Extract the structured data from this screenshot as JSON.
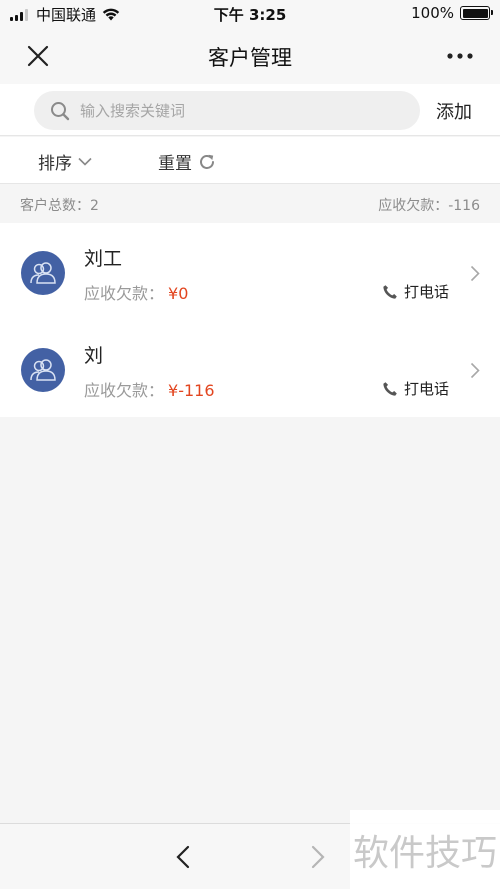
{
  "status_bar": {
    "carrier": "中国联通",
    "time": "下午 3:25",
    "battery": "100%",
    "battery_level": 1.0,
    "signal_bars": 3,
    "signal_total": 4
  },
  "nav": {
    "title": "客户管理",
    "close_icon": "close-icon",
    "more_icon": "more-dots-icon"
  },
  "search": {
    "placeholder": "输入搜索关键词",
    "value": "",
    "add_label": "添加"
  },
  "filters": {
    "sort_label": "排序",
    "reset_label": "重置"
  },
  "summary": {
    "total_label": "客户总数：2",
    "receivable_label": "应收欠款：-116"
  },
  "customers": [
    {
      "name": "刘工",
      "debt_label": "应收欠款：",
      "debt_amount": "¥0",
      "call_label": "打电话"
    },
    {
      "name": "刘",
      "debt_label": "应收欠款：",
      "debt_amount": "¥-116",
      "call_label": "打电话"
    }
  ],
  "watermark": "软件技巧",
  "colors": {
    "accent_avatar": "#4361a4",
    "debt_red": "#e2451f"
  }
}
